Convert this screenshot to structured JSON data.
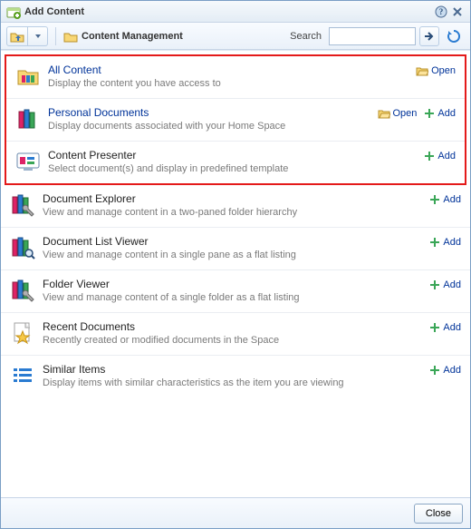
{
  "dialog": {
    "title": "Add Content"
  },
  "toolbar": {
    "breadcrumb": "Content Management",
    "search_label": "Search",
    "search_value": ""
  },
  "items": [
    {
      "title": "All Content",
      "desc": "Display the content you have access to",
      "open": true,
      "add": false,
      "link": true,
      "icon": "folder-content"
    },
    {
      "title": "Personal Documents",
      "desc": "Display documents associated with your Home Space",
      "open": true,
      "add": true,
      "link": true,
      "icon": "books"
    },
    {
      "title": "Content Presenter",
      "desc": "Select document(s) and display in predefined template",
      "open": false,
      "add": true,
      "link": false,
      "icon": "presenter"
    },
    {
      "title": "Document Explorer",
      "desc": "View and manage content in a two-paned folder hierarchy",
      "open": false,
      "add": true,
      "link": false,
      "icon": "books-wrench"
    },
    {
      "title": "Document List Viewer",
      "desc": "View and manage content in a single pane as a flat listing",
      "open": false,
      "add": true,
      "link": false,
      "icon": "books-search"
    },
    {
      "title": "Folder Viewer",
      "desc": "View and manage content of a single folder as a flat listing",
      "open": false,
      "add": true,
      "link": false,
      "icon": "books-wrench"
    },
    {
      "title": "Recent Documents",
      "desc": "Recently created or modified documents in the Space",
      "open": false,
      "add": true,
      "link": false,
      "icon": "doc-star"
    },
    {
      "title": "Similar Items",
      "desc": "Display items with similar characteristics as the item you are viewing",
      "open": false,
      "add": true,
      "link": false,
      "icon": "list"
    }
  ],
  "actions": {
    "open_label": "Open",
    "add_label": "Add"
  },
  "footer": {
    "close_label": "Close"
  }
}
